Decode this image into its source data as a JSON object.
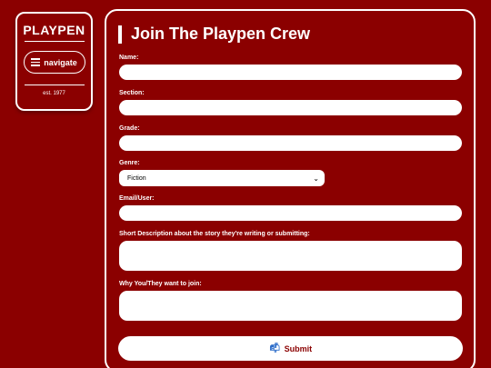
{
  "sidebar": {
    "brand": "PLAYPEN",
    "nav_label": "navigate",
    "est": "est. 1977"
  },
  "form": {
    "title": "Join The Playpen Crew",
    "fields": {
      "name_label": "Name:",
      "section_label": "Section:",
      "grade_label": "Grade:",
      "genre_label": "Genre:",
      "genre_value": "Fiction",
      "email_label": "Email/User:",
      "description_label": "Short Description about the story they're writing or submitting:",
      "why_label": "Why You/They want to join:"
    },
    "submit_label": "Submit"
  },
  "colors": {
    "background": "#8b0000",
    "foreground": "#ffffff"
  },
  "icons": {
    "nav": "menu-icon",
    "submit": "mailbox-icon",
    "select": "chevron-down-icon"
  }
}
